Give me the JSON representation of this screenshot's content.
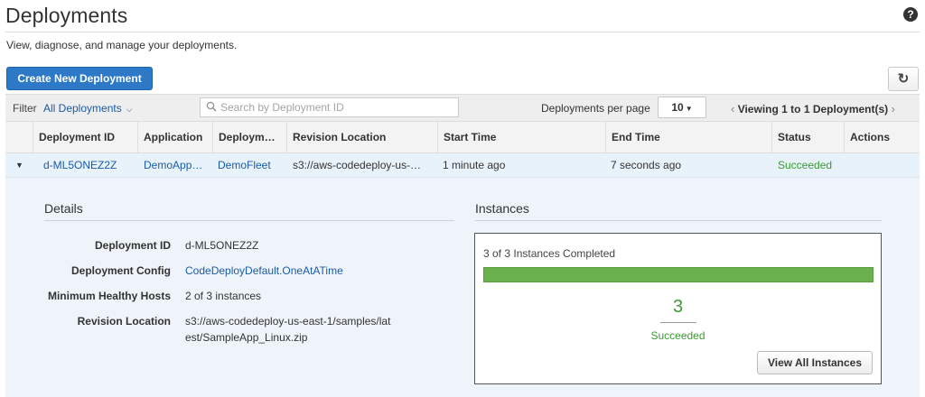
{
  "header": {
    "title": "Deployments",
    "help_icon": "question-circle-icon",
    "subtitle": "View, diagnose, and manage your deployments."
  },
  "toolbar": {
    "create_label": "Create New Deployment",
    "refresh_icon": "refresh-icon"
  },
  "filter": {
    "label": "Filter",
    "selected": "All Deployments",
    "search_placeholder": "Search by Deployment ID",
    "per_page_label": "Deployments per page",
    "per_page_value": "10",
    "pager_text": "Viewing 1 to 1 Deployment(s)"
  },
  "table": {
    "columns": [
      "Deployment ID",
      "Application",
      "Deploym…",
      "Revision Location",
      "Start Time",
      "End Time",
      "Status",
      "Actions"
    ],
    "rows": [
      {
        "deployment_id": "d-ML5ONEZ2Z",
        "application": "DemoApp…",
        "deployment_group": "DemoFleet",
        "revision_location": "s3://aws-codedeploy-us-…",
        "start_time": "1 minute ago",
        "end_time": "7 seconds ago",
        "status": "Succeeded",
        "actions": ""
      }
    ]
  },
  "details": {
    "title": "Details",
    "fields": [
      {
        "key": "Deployment ID",
        "value": "d-ML5ONEZ2Z"
      },
      {
        "key": "Deployment Config",
        "value": "CodeDeployDefault.OneAtATime"
      },
      {
        "key": "Minimum Healthy Hosts",
        "value": "2 of 3 instances"
      },
      {
        "key": "Revision Location",
        "value_line1": "s3://aws-codedeploy-us-east-1/samples/lat",
        "value_line2": "est/SampleApp_Linux.zip"
      }
    ]
  },
  "instances": {
    "title": "Instances",
    "summary": "3 of 3 Instances Completed",
    "progress_percent": 100,
    "count": "3",
    "status": "Succeeded",
    "view_all_label": "View All Instances"
  },
  "colors": {
    "primary_button": "#2d79c7",
    "link": "#1a5ba8",
    "success": "#3c9a33",
    "progress_fill": "#6ab04c"
  }
}
